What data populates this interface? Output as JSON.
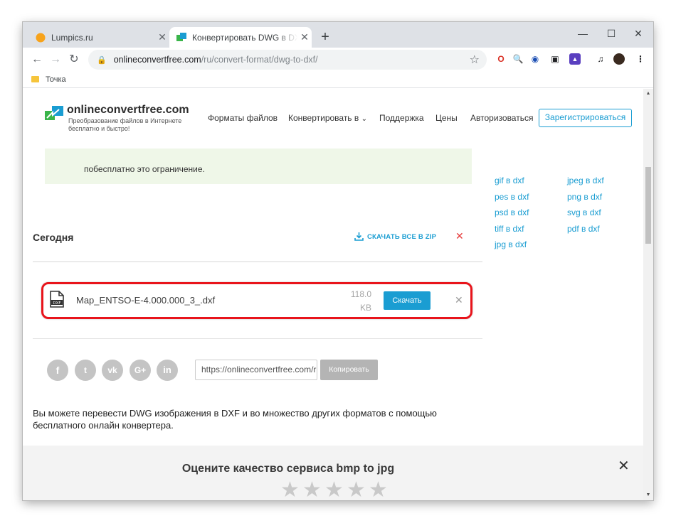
{
  "browser": {
    "tabs": [
      {
        "title": "Lumpics.ru",
        "active": false
      },
      {
        "title": "Конвертировать DWG в DXF онлайн",
        "active": true
      }
    ],
    "url_host": "onlineconvertfree.com",
    "url_path": "/ru/convert-format/dwg-to-dxf/",
    "bookmarks": [
      {
        "label": "Точка"
      }
    ]
  },
  "site": {
    "logo_name": "onlineconvertfree.com",
    "logo_tagline": "Преобразование файлов в Интернете бесплатно и быстро!",
    "menu": {
      "formats": "Форматы файлов",
      "convert": "Конвертировать в",
      "support": "Поддержка",
      "prices": "Цены",
      "login": "Авторизоваться",
      "register": "Зарегистрироваться"
    }
  },
  "content": {
    "green_partial_text": "побесплатно это ограничение.",
    "today_title": "Сегодня",
    "download_all": "СКАЧАТЬ ВСЕ В ZIP",
    "file": {
      "name": "Map_ENTSO-E-4.000.000_3_.dxf",
      "ext": "DXF",
      "size": "118.0 KB",
      "download_label": "Скачать"
    },
    "share_url": "https://onlineconvertfree.com/ru/convert-format/dwg-to-dxf/",
    "copy_label": "Копировать",
    "social": [
      "f",
      "t",
      "vk",
      "G+",
      "in"
    ],
    "description": "Вы можете перевести DWG изображения в DXF и во множество других форматов с помощью бесплатного онлайн конвертера."
  },
  "related": {
    "col1": [
      "gif в dxf",
      "pes в dxf",
      "psd в dxf",
      "tiff в dxf",
      "jpg в dxf"
    ],
    "col2": [
      "jpeg в dxf",
      "png в dxf",
      "svg в dxf",
      "pdf в dxf"
    ]
  },
  "rating": {
    "title": "Оцените качество сервиса bmp to jpg",
    "stars_total": 5
  },
  "colors": {
    "accent": "#1a9dd2",
    "highlight": "#e8141b",
    "danger": "#e63a3a"
  }
}
